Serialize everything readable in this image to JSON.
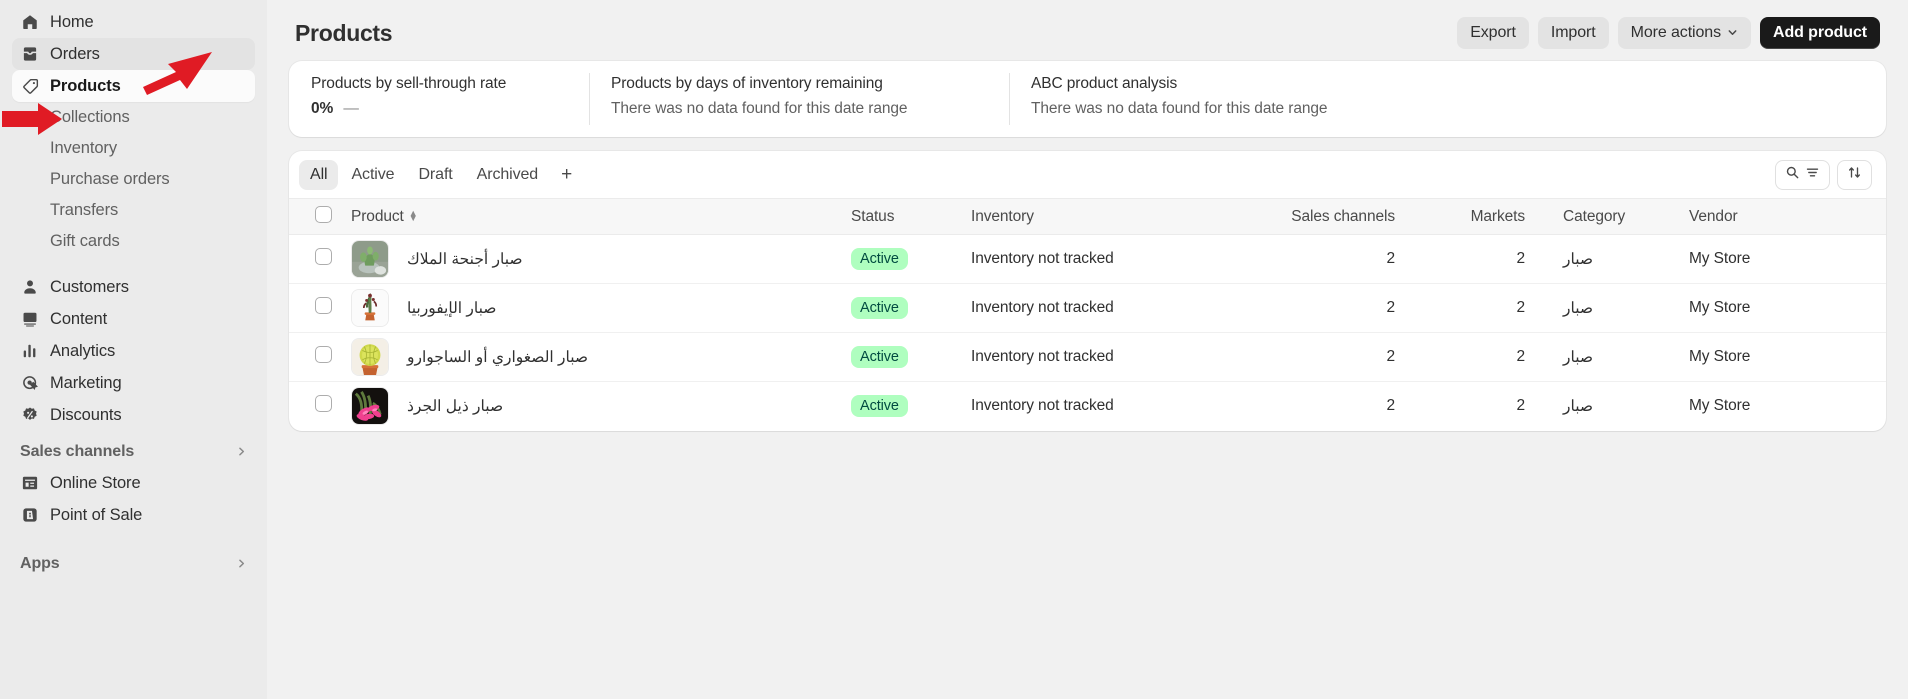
{
  "sidebar": {
    "items": [
      {
        "label": "Home",
        "icon": "home-icon",
        "state": "normal"
      },
      {
        "label": "Orders",
        "icon": "orders-inbox-icon",
        "state": "hover"
      },
      {
        "label": "Products",
        "icon": "product-tag-icon",
        "state": "active"
      }
    ],
    "sub_items": [
      {
        "label": "Collections"
      },
      {
        "label": "Inventory"
      },
      {
        "label": "Purchase orders"
      },
      {
        "label": "Transfers"
      },
      {
        "label": "Gift cards"
      }
    ],
    "items2": [
      {
        "label": "Customers",
        "icon": "person-icon"
      },
      {
        "label": "Content",
        "icon": "image-content-icon"
      },
      {
        "label": "Analytics",
        "icon": "bar-chart-icon"
      },
      {
        "label": "Marketing",
        "icon": "marketing-target-icon"
      },
      {
        "label": "Discounts",
        "icon": "discount-tag-icon"
      }
    ],
    "sales_channels": {
      "label": "Sales channels",
      "chevron": "chevron-right-icon",
      "items": [
        {
          "label": "Online Store",
          "icon": "storefront-icon"
        },
        {
          "label": "Point of Sale",
          "icon": "point-of-sale-icon"
        }
      ]
    },
    "apps": {
      "label": "Apps",
      "chevron": "chevron-right-icon"
    }
  },
  "header": {
    "title": "Products",
    "buttons": [
      {
        "label": "Export",
        "name": "export-button",
        "style": "secondary"
      },
      {
        "label": "Import",
        "name": "import-button",
        "style": "secondary"
      },
      {
        "label": "More actions",
        "name": "more-actions-button",
        "style": "secondary",
        "caret": "chevron-down-icon"
      },
      {
        "label": "Add product",
        "name": "add-product-button",
        "style": "primary"
      }
    ]
  },
  "analytics": {
    "metrics": [
      {
        "title": "Products by sell-through rate",
        "value": "0%",
        "delta": "—",
        "has_value": true
      },
      {
        "title": "Products by days of inventory remaining",
        "value": "There was no data found for this date range",
        "has_value": false
      },
      {
        "title": "ABC product analysis",
        "value": "There was no data found for this date range",
        "has_value": false
      }
    ]
  },
  "table_panel": {
    "tabs": [
      {
        "label": "All",
        "selected": true
      },
      {
        "label": "Active",
        "selected": false
      },
      {
        "label": "Draft",
        "selected": false
      },
      {
        "label": "Archived",
        "selected": false
      }
    ],
    "add_tab_label": "+",
    "tools": [
      {
        "name": "search-and-filter-button",
        "icon": "search-icon"
      },
      {
        "name": "sort-button",
        "icon": "sort-arrows-icon"
      }
    ],
    "columns": [
      {
        "key": "product",
        "label": "Product",
        "sortable": true
      },
      {
        "key": "status",
        "label": "Status",
        "sortable": false
      },
      {
        "key": "inventory",
        "label": "Inventory",
        "sortable": false
      },
      {
        "key": "sales_channels",
        "label": "Sales channels",
        "sortable": false
      },
      {
        "key": "markets",
        "label": "Markets",
        "sortable": false
      },
      {
        "key": "category",
        "label": "Category",
        "sortable": false
      },
      {
        "key": "vendor",
        "label": "Vendor",
        "sortable": false
      }
    ],
    "rows": [
      {
        "product": "صبار أجنحة الملاك",
        "status": "Active",
        "inventory": "Inventory not tracked",
        "sales_channels": "2",
        "markets": "2",
        "category": "صبار",
        "vendor": "My Store",
        "thumb": "cactus-in-bowl-thumbnail"
      },
      {
        "product": "صبار الإيفوربيا",
        "status": "Active",
        "inventory": "Inventory not tracked",
        "sales_channels": "2",
        "markets": "2",
        "category": "صبار",
        "vendor": "My Store",
        "thumb": "euphorbia-cactus-thumbnail"
      },
      {
        "product": "صبار الصغواري أو الساجوارو",
        "status": "Active",
        "inventory": "Inventory not tracked",
        "sales_channels": "2",
        "markets": "2",
        "category": "صبار",
        "vendor": "My Store",
        "thumb": "golden-barrel-cactus-thumbnail"
      },
      {
        "product": "صبار ذيل الجرذ",
        "status": "Active",
        "inventory": "Inventory not tracked",
        "sales_channels": "2",
        "markets": "2",
        "category": "صبار",
        "vendor": "My Store",
        "thumb": "rat-tail-cactus-flower-thumbnail"
      }
    ]
  },
  "annotations": {
    "arrow_color": "#e01b24",
    "arrows": [
      {
        "name": "arrow-pointing-to-products",
        "target": "Products"
      },
      {
        "name": "arrow-pointing-to-collections",
        "target": "Collections"
      }
    ]
  },
  "colors": {
    "accent_dark": "#1a1a1a",
    "sidebar_bg": "#ebebeb",
    "page_bg": "#f1f1f1",
    "badge_active_bg": "#affebf",
    "badge_active_text": "#014b40",
    "annotation_red": "#e01b24"
  }
}
